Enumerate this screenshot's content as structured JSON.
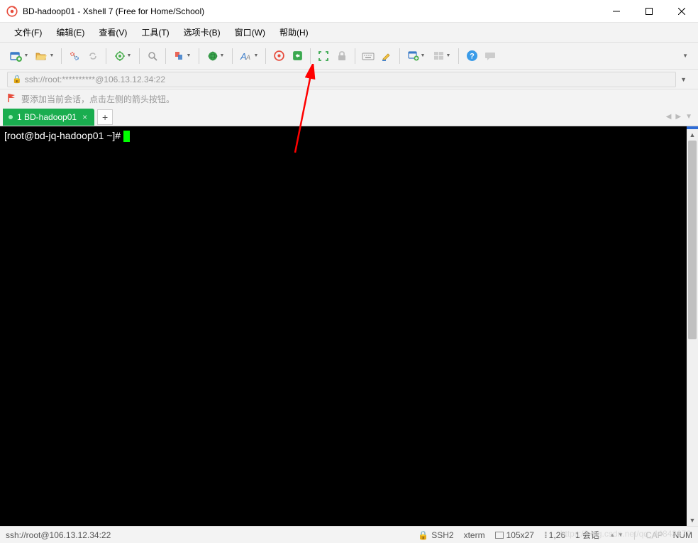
{
  "title": "BD-hadoop01 - Xshell 7 (Free for Home/School)",
  "menu": {
    "file": "文件(F)",
    "edit": "编辑(E)",
    "view": "查看(V)",
    "tools": "工具(T)",
    "tabs": "选项卡(B)",
    "window": "窗口(W)",
    "help": "帮助(H)"
  },
  "address": {
    "text": "ssh://root:**********@106.13.12.34:22"
  },
  "hint": "要添加当前会话，点击左侧的箭头按钮。",
  "tab": {
    "label": "1 BD-hadoop01"
  },
  "terminal": {
    "prompt": "[root@bd-jq-hadoop01 ~]# "
  },
  "status": {
    "conn": "ssh://root@106.13.12.34:22",
    "proto": "SSH2",
    "term": "xterm",
    "size": "105x27",
    "pos": "1,26",
    "sessions": "1 会话",
    "cap": "CAP",
    "num": "NUM"
  },
  "icons": {
    "new_session": "new-session",
    "open": "open-folder",
    "reconnect": "reconnect",
    "link": "link",
    "props": "properties",
    "find": "find",
    "copy": "copy",
    "globe": "globe",
    "font": "font",
    "xshell": "xshell-logo",
    "xftp": "xftp-logo",
    "fullscreen": "fullscreen",
    "lock": "lock",
    "keyboard": "keyboard",
    "highlight": "highlight",
    "newwin": "new-window",
    "tile": "tile",
    "help": "help",
    "chat": "chat"
  },
  "watermark": "https://blog.csdn.net/qq_44843672"
}
